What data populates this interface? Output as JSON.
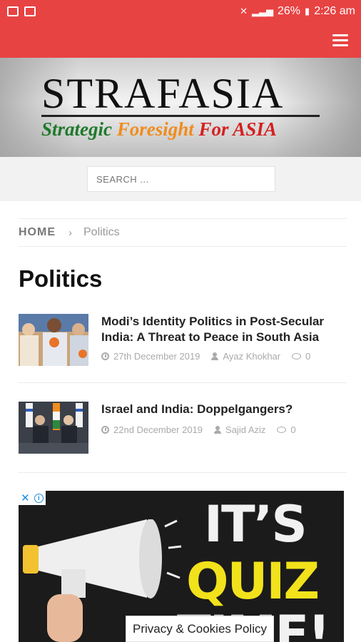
{
  "status_bar": {
    "battery": "26%",
    "time": "2:26 am"
  },
  "colors": {
    "header_red": "#e84343",
    "tag_green": "#1f7a2b",
    "tag_orange": "#f08c1e",
    "tag_red": "#d42020",
    "ad_yellow": "#f2e21b"
  },
  "logo": {
    "title": "STRAFASIA",
    "tagline_part1": "Strategic ",
    "tagline_part2": "Foresight",
    "tagline_part3": " For ASIA"
  },
  "search": {
    "placeholder": "SEARCH ..."
  },
  "breadcrumb": {
    "home": "HOME",
    "separator": "›",
    "current": "Politics"
  },
  "page_title": "Politics",
  "articles": [
    {
      "title": "Modi’s Identity Politics in Post-Secular India: A Threat to Peace in South Asia",
      "date": "27th December 2019",
      "author": "Ayaz Khokhar",
      "comments": "0"
    },
    {
      "title": "Israel and India: Doppelgangers?",
      "date": "22nd December 2019",
      "author": "Sajid Aziz",
      "comments": "0"
    }
  ],
  "ad": {
    "close_label": "✕",
    "info_label": "i",
    "line1": "IT’S",
    "line2": "QUIZ",
    "line3": "TIME!"
  },
  "privacy_button": "Privacy & Cookies Policy"
}
